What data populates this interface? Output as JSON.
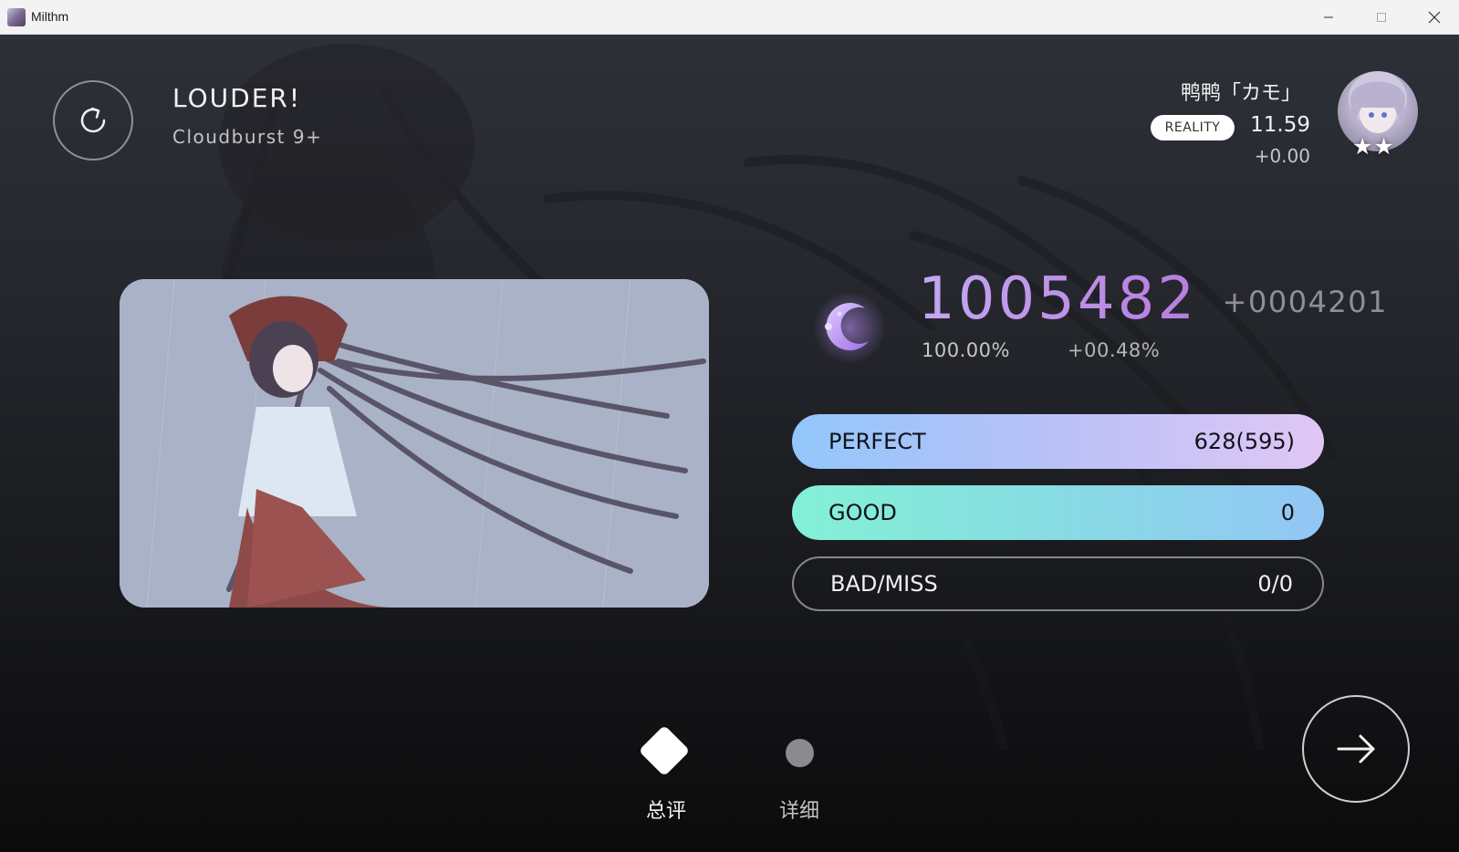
{
  "window": {
    "title": "Milthm",
    "icon": "app-icon"
  },
  "song": {
    "title": "LOUDER!",
    "difficulty": "Cloudburst 9+"
  },
  "player": {
    "name": "鸭鸭「カモ」",
    "badge": "REALITY",
    "rks": "11.59",
    "rks_delta": "+0.00",
    "avatar_stars": "★★"
  },
  "result": {
    "score": "1005482",
    "score_delta": "+0004201",
    "accuracy": "100.00%",
    "accuracy_delta": "+00.48%",
    "grade_icon": "crescent-moon-icon"
  },
  "judgements": [
    {
      "label": "PERFECT",
      "value": "628(595)"
    },
    {
      "label": "GOOD",
      "value": "0"
    },
    {
      "label": "BAD/MISS",
      "value": "0/0"
    }
  ],
  "pages": [
    {
      "label": "总评",
      "active": true
    },
    {
      "label": "详细",
      "active": false
    }
  ],
  "colors": {
    "score_gradient_start": "#c3a8f4",
    "score_gradient_end": "#b77ddc",
    "perfect_gradient_start": "#92c7fb",
    "perfect_gradient_end": "#e0c6f5",
    "good_gradient_start": "#83f1d6",
    "good_gradient_end": "#92c6f5"
  }
}
